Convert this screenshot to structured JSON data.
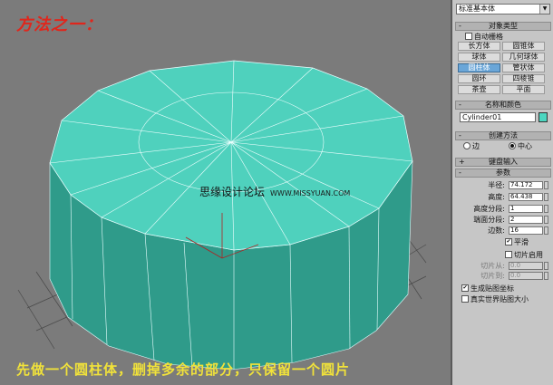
{
  "viewport": {
    "title_overlay": "方法之一：",
    "caption": "先做一个圆柱体，删掉多余的部分，只保留一个圆片",
    "watermark_text": "思缘设计论坛",
    "watermark_url": "WWW.MISSYUAN.COM",
    "colors": {
      "background": "#7b7b7b",
      "cylinder_top": "#4fd1bd",
      "cylinder_side": "#2f9b8a"
    }
  },
  "panel": {
    "dropdown_value": "标准基本体",
    "object_type": {
      "title": "对象类型",
      "auto_grid": "自动栅格",
      "buttons": [
        "长方体",
        "圆锥体",
        "球体",
        "几何球体",
        "圆柱体",
        "管状体",
        "圆环",
        "四棱锥",
        "茶壶",
        "平面"
      ],
      "active_index": 4
    },
    "name_color": {
      "title": "名称和颜色",
      "name_value": "Cylinder01",
      "color": "#4cd6c0"
    },
    "creation_method": {
      "title": "创建方法",
      "option_edge": "边",
      "option_center": "中心",
      "selected": "center"
    },
    "keyboard_entry": {
      "title": "键盘输入"
    },
    "parameters": {
      "title": "参数",
      "rows": [
        {
          "label": "半径:",
          "value": "74.172"
        },
        {
          "label": "高度:",
          "value": "64.438"
        },
        {
          "label": "高度分段:",
          "value": "1"
        },
        {
          "label": "端面分段:",
          "value": "2"
        },
        {
          "label": "边数:",
          "value": "16"
        }
      ],
      "smooth_label": "平滑",
      "slice_on_label": "切片启用",
      "slice_rows": [
        {
          "label": "切片从:",
          "value": "0.0"
        },
        {
          "label": "切片到:",
          "value": "0.0"
        }
      ],
      "gen_map_coords": "生成贴图坐标",
      "real_world_map": "真实世界贴图大小"
    }
  }
}
